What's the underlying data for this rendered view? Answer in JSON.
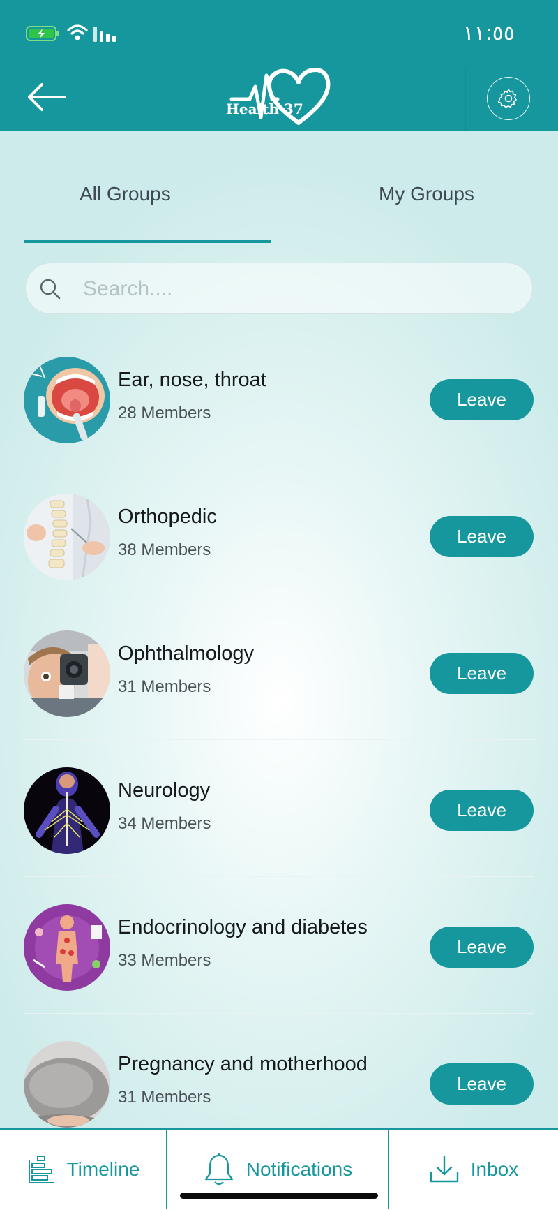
{
  "status_bar": {
    "time": "١١:٥٥"
  },
  "header": {
    "logo_text": "Health 37"
  },
  "tabs": [
    {
      "label": "All Groups"
    },
    {
      "label": "My Groups"
    }
  ],
  "search": {
    "placeholder": "Search...."
  },
  "groups": [
    {
      "name": "Ear, nose, throat",
      "members": "28 Members",
      "action": "Leave",
      "avatar_icon": "throat-illustration"
    },
    {
      "name": "Orthopedic",
      "members": "38 Members",
      "action": "Leave",
      "avatar_icon": "spine-model-photo"
    },
    {
      "name": "Ophthalmology",
      "members": "31 Members",
      "action": "Leave",
      "avatar_icon": "eye-exam-photo"
    },
    {
      "name": "Neurology",
      "members": "34 Members",
      "action": "Leave",
      "avatar_icon": "nervous-system-illustration"
    },
    {
      "name": " Endocrinology and diabetes",
      "members": "33 Members",
      "action": "Leave",
      "avatar_icon": "endocrine-illustration"
    },
    {
      "name": "Pregnancy and motherhood",
      "members": "31 Members",
      "action": "Leave",
      "avatar_icon": "pregnancy-photo"
    }
  ],
  "bottom_nav": [
    {
      "label": "Timeline",
      "icon": "timeline-icon"
    },
    {
      "label": "Notifications",
      "icon": "bell-icon"
    },
    {
      "label": "Inbox",
      "icon": "inbox-download-icon"
    }
  ],
  "colors": {
    "accent": "#15979d",
    "background": "#e6f6f5",
    "title_text": "#161a1d"
  }
}
